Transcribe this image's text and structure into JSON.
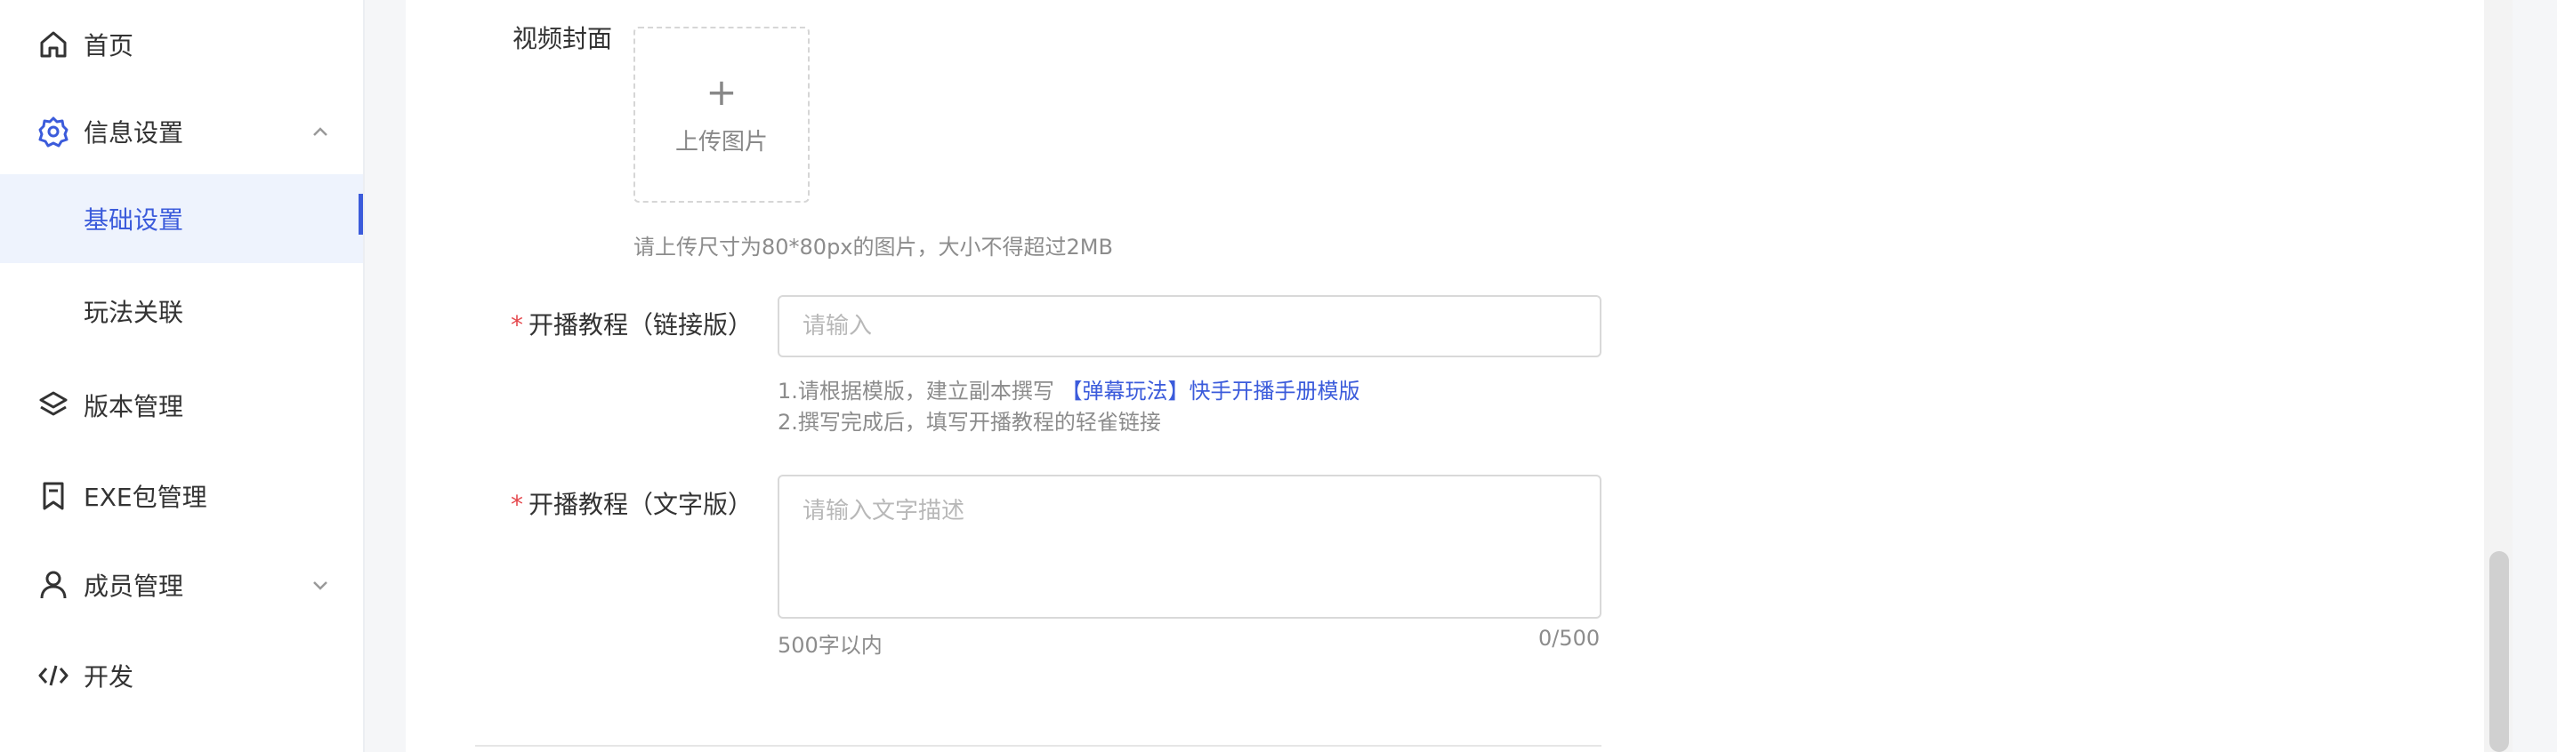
{
  "sidebar": {
    "items": [
      {
        "label": "首页",
        "icon": "home-icon"
      },
      {
        "label": "信息设置",
        "icon": "gear-icon",
        "expanded": true
      },
      {
        "label": "基础设置",
        "active": true
      },
      {
        "label": "玩法关联"
      },
      {
        "label": "版本管理",
        "icon": "layers-icon"
      },
      {
        "label": "EXE包管理",
        "icon": "bookmark-icon"
      },
      {
        "label": "成员管理",
        "icon": "user-icon",
        "expanded": false
      },
      {
        "label": "开发",
        "icon": "code-icon"
      }
    ]
  },
  "form": {
    "cover": {
      "label": "视频封面",
      "upload_text": "上传图片",
      "hint": "请上传尺寸为80*80px的图片，大小不得超过2MB"
    },
    "tutorial_link": {
      "label": "开播教程（链接版）",
      "placeholder": "请输入",
      "hint_line1_prefix": "1.请根据模版，建立副本撰写",
      "hint_line1_link": "【弹幕玩法】快手开播手册模版",
      "hint_line2": "2.撰写完成后，填写开播教程的轻雀链接"
    },
    "tutorial_text": {
      "label": "开播教程（文字版）",
      "placeholder": "请输入文字描述",
      "limit_hint": "500字以内",
      "counter": "0/500"
    }
  },
  "colors": {
    "accent": "#3b5bdb",
    "required": "#e5484d",
    "active_bg": "#eef3fd"
  }
}
